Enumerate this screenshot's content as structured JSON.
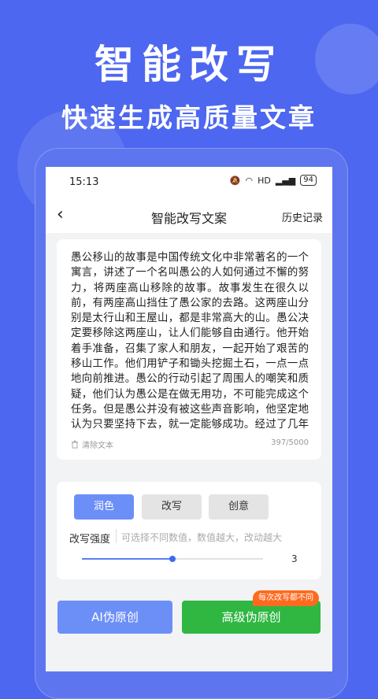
{
  "promo": {
    "headline": "智能改写",
    "subheadline": "快速生成高质量文章"
  },
  "statusbar": {
    "time": "15:13",
    "hd": "HD",
    "battery": "94"
  },
  "navbar": {
    "back_icon": "chevron-left-icon",
    "title": "智能改写文案",
    "history_label": "历史记录"
  },
  "editor": {
    "text": "愚公移山的故事是中国传统文化中非常著名的一个寓言，讲述了一个名叫愚公的人如何通过不懈的努力，将两座高山移除的故事。故事发生在很久以前，有两座高山挡住了愚公家的去路。这两座山分别是太行山和王屋山，都是非常高大的山。愚公决定要移除这两座山，让人们能够自由通行。他开始着手准备，召集了家人和朋友，一起开始了艰苦的移山工作。他们用铲子和锄头挖掘土石，一点一点地向前推进。愚公的行动引起了周围人的嘲笑和质疑，他们认为愚公是在做无用功，不可能完成这个任务。但是愚公并没有被这些声音影响，他坚定地认为只要坚持下去，就一定能够成功。经过了几年的努力，愚公和他的家人朋友们终于将两座高山移除，开辟出了一条通往家门口的道路。这个故事告诉我们，只要我们坚持不懈地努力，克服困难，就一定能够取得",
    "clear_label": "清除文本",
    "counter": "397/5000"
  },
  "options": {
    "modes": [
      "润色",
      "改写",
      "创意"
    ],
    "active_mode": "润色",
    "strength_label": "改写强度",
    "strength_hint": "可选择不同数值，数值越大，改动越大",
    "strength_value": "3",
    "strength_fraction": 0.5
  },
  "actions": {
    "ai_label": "AI伪原创",
    "advanced_label": "高级伪原创",
    "badge": "每次改写都不同"
  },
  "colors": {
    "background": "#4d67f0",
    "accent": "#6c8ff7",
    "green": "#2fb742",
    "badge": "#ff6a1f"
  }
}
